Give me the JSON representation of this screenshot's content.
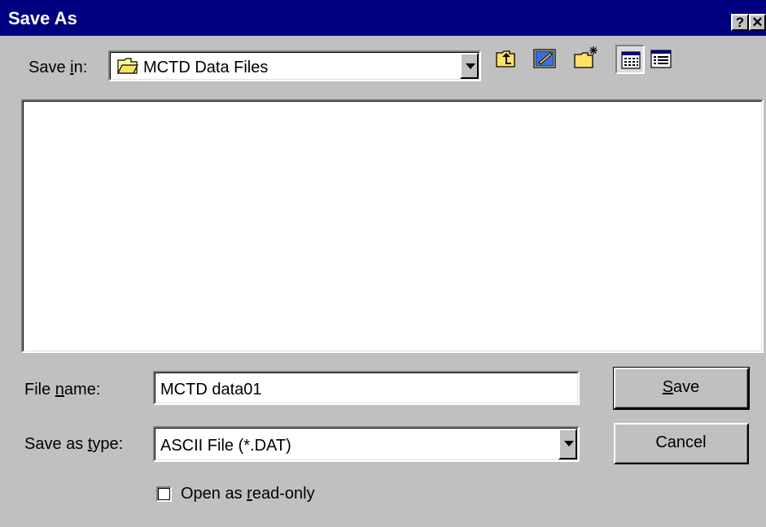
{
  "window": {
    "title": "Save As",
    "help_button": "?",
    "close_button": "✕"
  },
  "save_in": {
    "label_pre": "Save ",
    "label_key": "i",
    "label_post": "n:",
    "value": "MCTD Data Files",
    "icon": "folder-open-icon"
  },
  "toolbar": [
    {
      "name": "up-one-level-icon"
    },
    {
      "name": "view-desktop-icon"
    },
    {
      "name": "new-folder-icon"
    },
    {
      "name": "list-view-icon"
    },
    {
      "name": "details-view-icon"
    }
  ],
  "file_name": {
    "label_pre": "File ",
    "label_key": "n",
    "label_post": "ame:",
    "value": "MCTD data01"
  },
  "save_as_type": {
    "label_pre": "Save as ",
    "label_key": "t",
    "label_post": "ype:",
    "value": "ASCII File (*.DAT)"
  },
  "buttons": {
    "save_key": "S",
    "save_rest": "ave",
    "cancel": "Cancel"
  },
  "read_only": {
    "label_pre": "Open as ",
    "label_key": "r",
    "label_post": "ead-only",
    "checked": false
  },
  "colors": {
    "titlebar": "#000080",
    "face": "#c0c0c0",
    "window_bg": "#ffffff"
  }
}
